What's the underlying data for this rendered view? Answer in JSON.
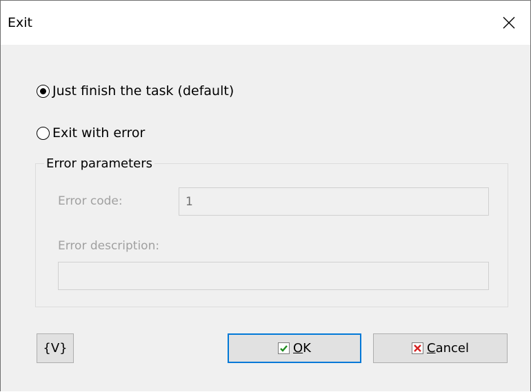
{
  "window": {
    "title": "Exit"
  },
  "options": {
    "finish_label": "Just finish the task (default)",
    "error_label": "Exit with error",
    "selected": "finish"
  },
  "error_params": {
    "legend": "Error parameters",
    "code_label": "Error code:",
    "code_value": "1",
    "description_label": "Error description:",
    "description_value": ""
  },
  "buttons": {
    "variables": "{V}",
    "ok_accel": "O",
    "ok_rest": "K",
    "cancel_accel": "C",
    "cancel_rest": "ancel"
  },
  "colors": {
    "ok_check": "#1e8c1e",
    "cancel_x": "#d42020",
    "focus_border": "#0078d7"
  }
}
